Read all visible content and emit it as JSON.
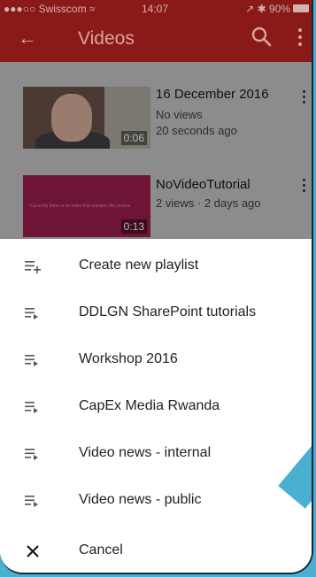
{
  "status_bar": {
    "carrier": "●●●○○ Swisscom ≈",
    "time": "14:07",
    "right": "↗ ✱ 90%"
  },
  "app_bar": {
    "title": "Videos",
    "back_icon": "arrow-left-icon",
    "search_icon": "search-icon",
    "menu_icon": "kebab-icon"
  },
  "videos": [
    {
      "title": "16 December 2016",
      "meta1": "No views",
      "meta2": "20 seconds ago",
      "duration": "0:06"
    },
    {
      "title": "NoVideoTutorial",
      "meta1": "2 views · 2 days ago",
      "duration": "0:13"
    }
  ],
  "sheet": {
    "items": [
      {
        "label": "Create new playlist",
        "icon": "playlist-add-icon"
      },
      {
        "label": "DDLGN SharePoint tutorials",
        "icon": "playlist-play-icon"
      },
      {
        "label": "Workshop 2016",
        "icon": "playlist-play-icon"
      },
      {
        "label": "CapEx Media Rwanda",
        "icon": "playlist-play-icon"
      },
      {
        "label": "Video news - internal",
        "icon": "playlist-play-icon"
      },
      {
        "label": "Video news - public",
        "icon": "playlist-play-icon"
      },
      {
        "label": "Cancel",
        "icon": "close-icon"
      }
    ]
  },
  "colors": {
    "app_bar": "#8a1a18",
    "backdrop": "#4ab0cf",
    "dim": "#8c8c8c"
  }
}
